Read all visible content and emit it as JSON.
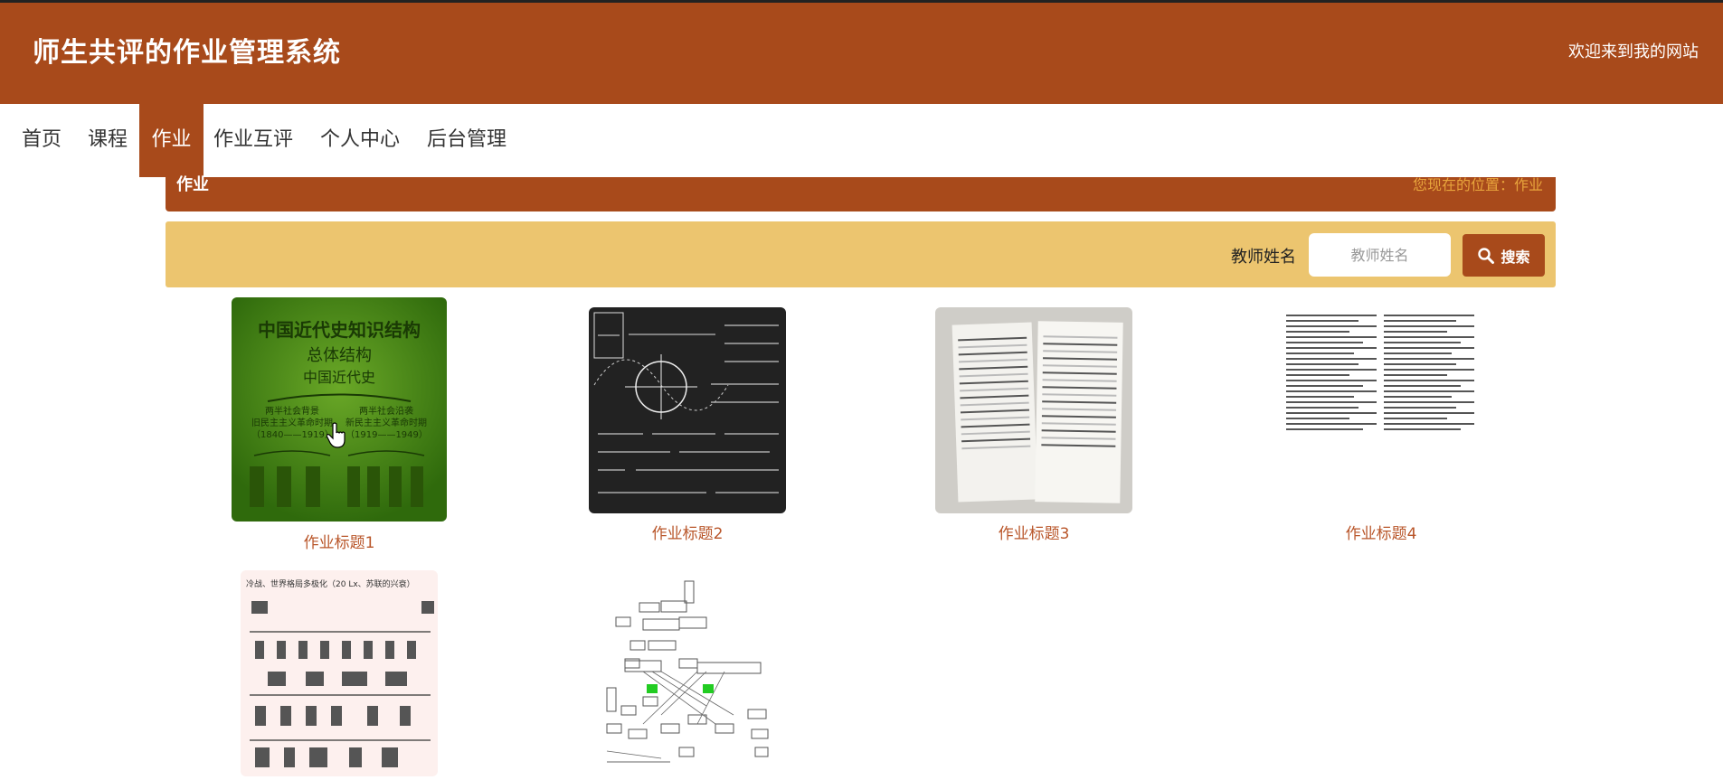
{
  "header": {
    "title": "师生共评的作业管理系统",
    "welcome": "欢迎来到我的网站"
  },
  "nav": {
    "items": [
      {
        "label": "首页",
        "active": false
      },
      {
        "label": "课程",
        "active": false
      },
      {
        "label": "作业",
        "active": true
      },
      {
        "label": "作业互评",
        "active": false
      },
      {
        "label": "个人中心",
        "active": false
      },
      {
        "label": "后台管理",
        "active": false
      }
    ]
  },
  "section": {
    "title": "作业",
    "breadcrumb": "您现在的位置：作业"
  },
  "search": {
    "label": "教师姓名",
    "placeholder": "教师姓名",
    "value": "",
    "button_label": "搜索"
  },
  "thumb_text": {
    "history_title": "中国近代史知识结构",
    "history_subtitle": "总体结构",
    "history_root": "中国近代史",
    "history_left": "两半社会背景",
    "history_left_2": "旧民主主义革命时期",
    "history_left_years": "（1840——1919）",
    "history_right": "两半社会沿袭",
    "history_right_2": "新民主主义革命时期",
    "history_right_years": "（1919——1949）",
    "timeline_title": "冷战、世界格局多极化（20 Lx、苏联的兴衰）"
  },
  "assignments": [
    {
      "title": "作业标题1"
    },
    {
      "title": "作业标题2"
    },
    {
      "title": "作业标题3"
    },
    {
      "title": "作业标题4"
    },
    {
      "title": ""
    },
    {
      "title": ""
    }
  ],
  "colors": {
    "primary": "#a84a1b",
    "search_bg": "#ecc56f",
    "breadcrumb": "#e8a43c",
    "caption": "#b9562a"
  }
}
